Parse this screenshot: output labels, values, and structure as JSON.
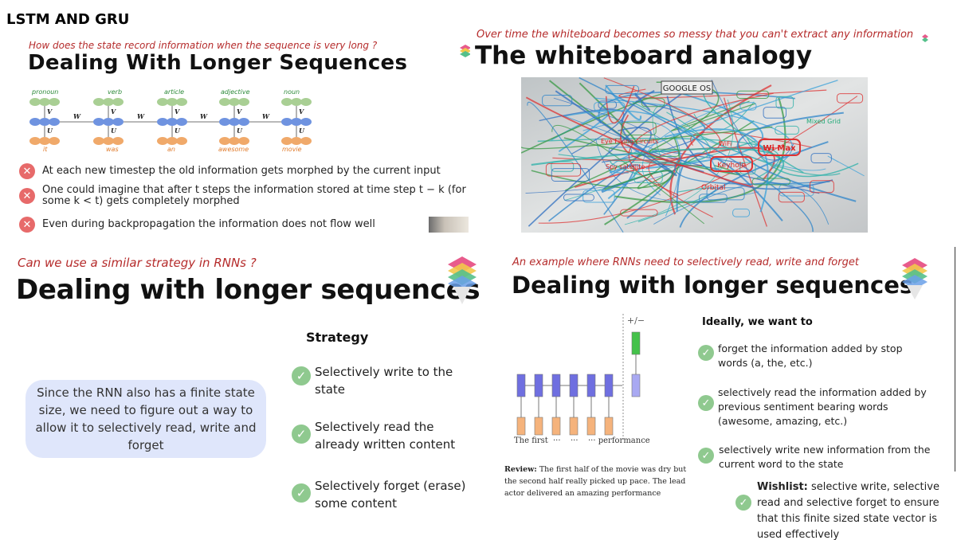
{
  "page_title": "LSTM AND GRU",
  "panel_tl": {
    "subtitle": "How does the state record information when the sequence is very long ?",
    "heading": "Dealing With Longer Sequences",
    "top_labels": [
      "pronoun",
      "verb",
      "article",
      "adjective",
      "noun"
    ],
    "bottom_labels": [
      "it",
      "was",
      "an",
      "awesome",
      "movie"
    ],
    "v_label": "V",
    "u_label": "U",
    "w_label": "W",
    "bullets": [
      "At each new timestep the old information gets morphed by the current input",
      "One could imagine that after t steps the information stored at time step t − k (for some k < t) gets completely morphed",
      "Even during backpropagation the information does not flow well"
    ]
  },
  "panel_tr": {
    "subtitle": "Over time the whiteboard becomes so messy that you can't extract any information",
    "heading": "The whiteboard analogy",
    "board_label": "GOOGLE OS",
    "board_words": [
      "Wi Max",
      "Keyhole",
      "Orbital",
      "Spy satellite",
      "WiFi",
      "Mixed Grid",
      "Eye Flying circuits"
    ]
  },
  "panel_bl": {
    "subtitle": "Can we use a similar strategy in RNNs ?",
    "heading": "Dealing with longer sequences",
    "callout": "Since the RNN also has a finite state size, we need to figure out a way to allow it to selectively read, write and forget",
    "strategy_title": "Strategy",
    "items": [
      "Selectively write to the state",
      "Selectively read the already written content",
      "Selectively forget (erase) some content"
    ]
  },
  "panel_br": {
    "subtitle": "An example where RNNs need to selectively read, write and forget",
    "heading": "Dealing with longer sequences",
    "plusminus": "+/−",
    "diagram_labels": [
      "The first",
      "···",
      "···",
      "··· performance"
    ],
    "review_label": "Review:",
    "review_text": "The first half of the movie was dry but the second half really picked up pace. The lead actor delivered an amazing performance",
    "ideally_title": "Ideally, we want to",
    "items": [
      "forget the information added by stop words (a, the, etc.)",
      "selectively read the information added by previous sentiment bearing words (awesome, amazing, etc.)",
      "selectively write new information from the current word to the state"
    ],
    "wishlist_label": "Wishlist:",
    "wishlist_text": "selective write, selective read and selective forget to ensure that this finite sized state vector is used effectively"
  },
  "colors": {
    "subtitle_red": "#b52b2b",
    "check_green": "#8fc98f",
    "x_red": "#e76a6a",
    "callout_bg": "#dfe6fb"
  }
}
